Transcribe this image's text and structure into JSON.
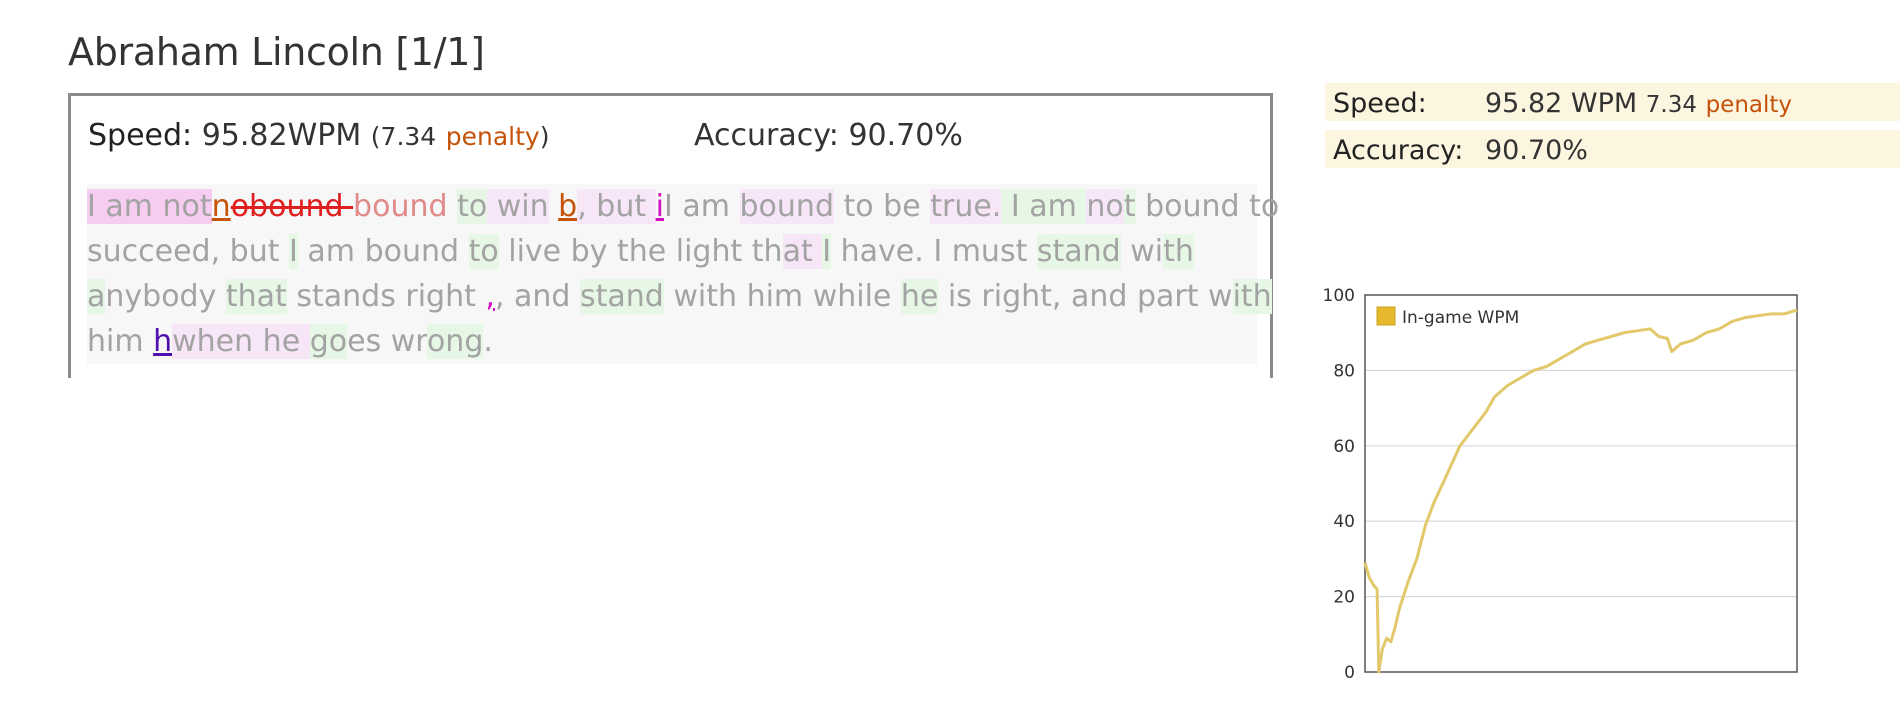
{
  "header": {
    "title": "Abraham Lincoln [1/1]"
  },
  "result": {
    "speed_label": "Speed:",
    "speed_value": "95.82WPM",
    "open_paren": "(",
    "penalty_value": "7.34",
    "penalty_label": "penalty",
    "close_paren": ")",
    "accuracy_label": "Accuracy:",
    "accuracy_value": "90.70%"
  },
  "passage": {
    "segments": [
      {
        "t": "I am not",
        "c": "pp"
      },
      {
        "t": "n",
        "c": "ins-o"
      },
      {
        "t": "obound ",
        "c": "strike"
      },
      {
        "t": "bound",
        "c": "err"
      },
      {
        "t": " ",
        "c": ""
      },
      {
        "t": "to",
        "c": "g"
      },
      {
        "t": " win",
        "c": "p"
      },
      {
        "t": " ",
        "c": ""
      },
      {
        "t": "b",
        "c": "ins-o"
      },
      {
        "t": ", but ",
        "c": "p"
      },
      {
        "t": "i",
        "c": "ins-m"
      },
      {
        "t": "I am ",
        "c": ""
      },
      {
        "t": "bound",
        "c": "p"
      },
      {
        "t": " to be ",
        "c": ""
      },
      {
        "t": "true.",
        "c": "p"
      },
      {
        "t": " I am ",
        "c": "g"
      },
      {
        "t": "no",
        "c": "p"
      },
      {
        "t": "t",
        "c": "g"
      },
      {
        "t": " bound to ",
        "c": ""
      },
      {
        "t": "succeed, but ",
        "c": ""
      },
      {
        "t": "I",
        "c": "g"
      },
      {
        "t": " am bound ",
        "c": ""
      },
      {
        "t": "to",
        "c": "g"
      },
      {
        "t": " live by the light th",
        "c": ""
      },
      {
        "t": "at ",
        "c": "p"
      },
      {
        "t": "I",
        "c": "g"
      },
      {
        "t": " have. I must ",
        "c": ""
      },
      {
        "t": "stand",
        "c": "g"
      },
      {
        "t": " wi",
        "c": ""
      },
      {
        "t": "th",
        "c": "g"
      },
      {
        "t": "a",
        "c": "g"
      },
      {
        "t": "nybody ",
        "c": ""
      },
      {
        "t": "that",
        "c": "g"
      },
      {
        "t": " stands right",
        "c": ""
      },
      {
        "t": " ",
        "c": ""
      },
      {
        "t": ",",
        "c": "ins-m"
      },
      {
        "t": ", and ",
        "c": ""
      },
      {
        "t": "stand",
        "c": "g"
      },
      {
        "t": " with him while ",
        "c": ""
      },
      {
        "t": "he",
        "c": "g"
      },
      {
        "t": " is right, and part w",
        "c": ""
      },
      {
        "t": "ith",
        "c": "g"
      },
      {
        "t": "him ",
        "c": ""
      },
      {
        "t": "h",
        "c": "ins-v"
      },
      {
        "t": "when he ",
        "c": "p"
      },
      {
        "t": "go",
        "c": "g"
      },
      {
        "t": "es wr",
        "c": ""
      },
      {
        "t": "ong",
        "c": "g"
      },
      {
        "t": ".",
        "c": ""
      }
    ],
    "line_breaks_after": [
      18,
      29,
      41
    ]
  },
  "summary": {
    "speed_label": "Speed:",
    "speed_value": "95.82 WPM",
    "penalty_value": "7.34",
    "penalty_label": "penalty",
    "accuracy_label": "Accuracy:",
    "accuracy_value": "90.70%"
  },
  "chart_data": {
    "type": "line",
    "legend": "In-game WPM",
    "legend_position": "top-left",
    "grid": true,
    "ylim": [
      0,
      100
    ],
    "yticks": [
      "0",
      "20",
      "40",
      "60",
      "80",
      "100"
    ],
    "xlim": [
      0,
      100
    ],
    "color": "#e2c86a",
    "series": [
      {
        "name": "In-game WPM",
        "x": [
          0,
          1,
          2,
          2.8,
          3.2,
          4,
          5,
          6,
          7,
          8,
          10,
          12,
          14,
          16,
          18,
          20,
          22,
          24,
          26,
          28,
          30,
          33,
          36,
          39,
          42,
          45,
          48,
          51,
          54,
          57,
          60,
          63,
          66,
          68,
          70,
          71,
          73,
          76,
          79,
          82,
          85,
          88,
          91,
          94,
          97,
          100
        ],
        "y": [
          29,
          25,
          23,
          22,
          0,
          6,
          9,
          8,
          12,
          17,
          24,
          30,
          39,
          45,
          50,
          55,
          60,
          63,
          66,
          69,
          73,
          76,
          78,
          80,
          81,
          83,
          85,
          87,
          88,
          89,
          90,
          90.5,
          91,
          89,
          88.5,
          85,
          87,
          88,
          90,
          91,
          93,
          94,
          94.5,
          95,
          95,
          96
        ]
      }
    ]
  }
}
